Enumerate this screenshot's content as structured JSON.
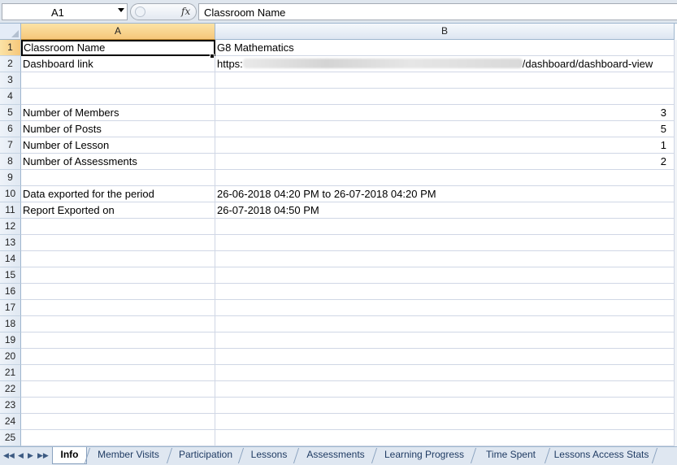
{
  "formula_bar": {
    "name_box": "A1",
    "fx_label": "fx",
    "formula": "Classroom Name"
  },
  "columns": [
    "A",
    "B"
  ],
  "rows": [
    {
      "num": "1",
      "a": "Classroom Name",
      "b": "G8 Mathematics"
    },
    {
      "num": "2",
      "a": "Dashboard link",
      "b_prefix": "https:",
      "b_suffix": "/dashboard/dashboard-view"
    },
    {
      "num": "3",
      "a": "",
      "b": ""
    },
    {
      "num": "4",
      "a": "",
      "b": ""
    },
    {
      "num": "5",
      "a": "Number of Members",
      "b": "3"
    },
    {
      "num": "6",
      "a": "Number of Posts",
      "b": "5"
    },
    {
      "num": "7",
      "a": "Number of Lesson",
      "b": "1"
    },
    {
      "num": "8",
      "a": "Number of Assessments",
      "b": "2"
    },
    {
      "num": "9",
      "a": "",
      "b": ""
    },
    {
      "num": "10",
      "a": "Data exported for the period",
      "b": "26-06-2018 04:20 PM to 26-07-2018 04:20 PM"
    },
    {
      "num": "11",
      "a": "Report Exported on",
      "b": "26-07-2018 04:50 PM"
    },
    {
      "num": "12"
    },
    {
      "num": "13"
    },
    {
      "num": "14"
    },
    {
      "num": "15"
    },
    {
      "num": "16"
    },
    {
      "num": "17"
    },
    {
      "num": "18"
    },
    {
      "num": "19"
    },
    {
      "num": "20"
    },
    {
      "num": "21"
    },
    {
      "num": "22"
    },
    {
      "num": "23"
    },
    {
      "num": "24"
    },
    {
      "num": "25"
    }
  ],
  "sheet_nav": [
    "first-sheet",
    "prev-sheet",
    "next-sheet",
    "last-sheet"
  ],
  "sheet_tabs": [
    "Info",
    "Member Visits",
    "Participation",
    "Lessons",
    "Assessments",
    "Learning Progress",
    "Time Spent",
    "Lessons Access Stats"
  ],
  "active_tab": "Info"
}
